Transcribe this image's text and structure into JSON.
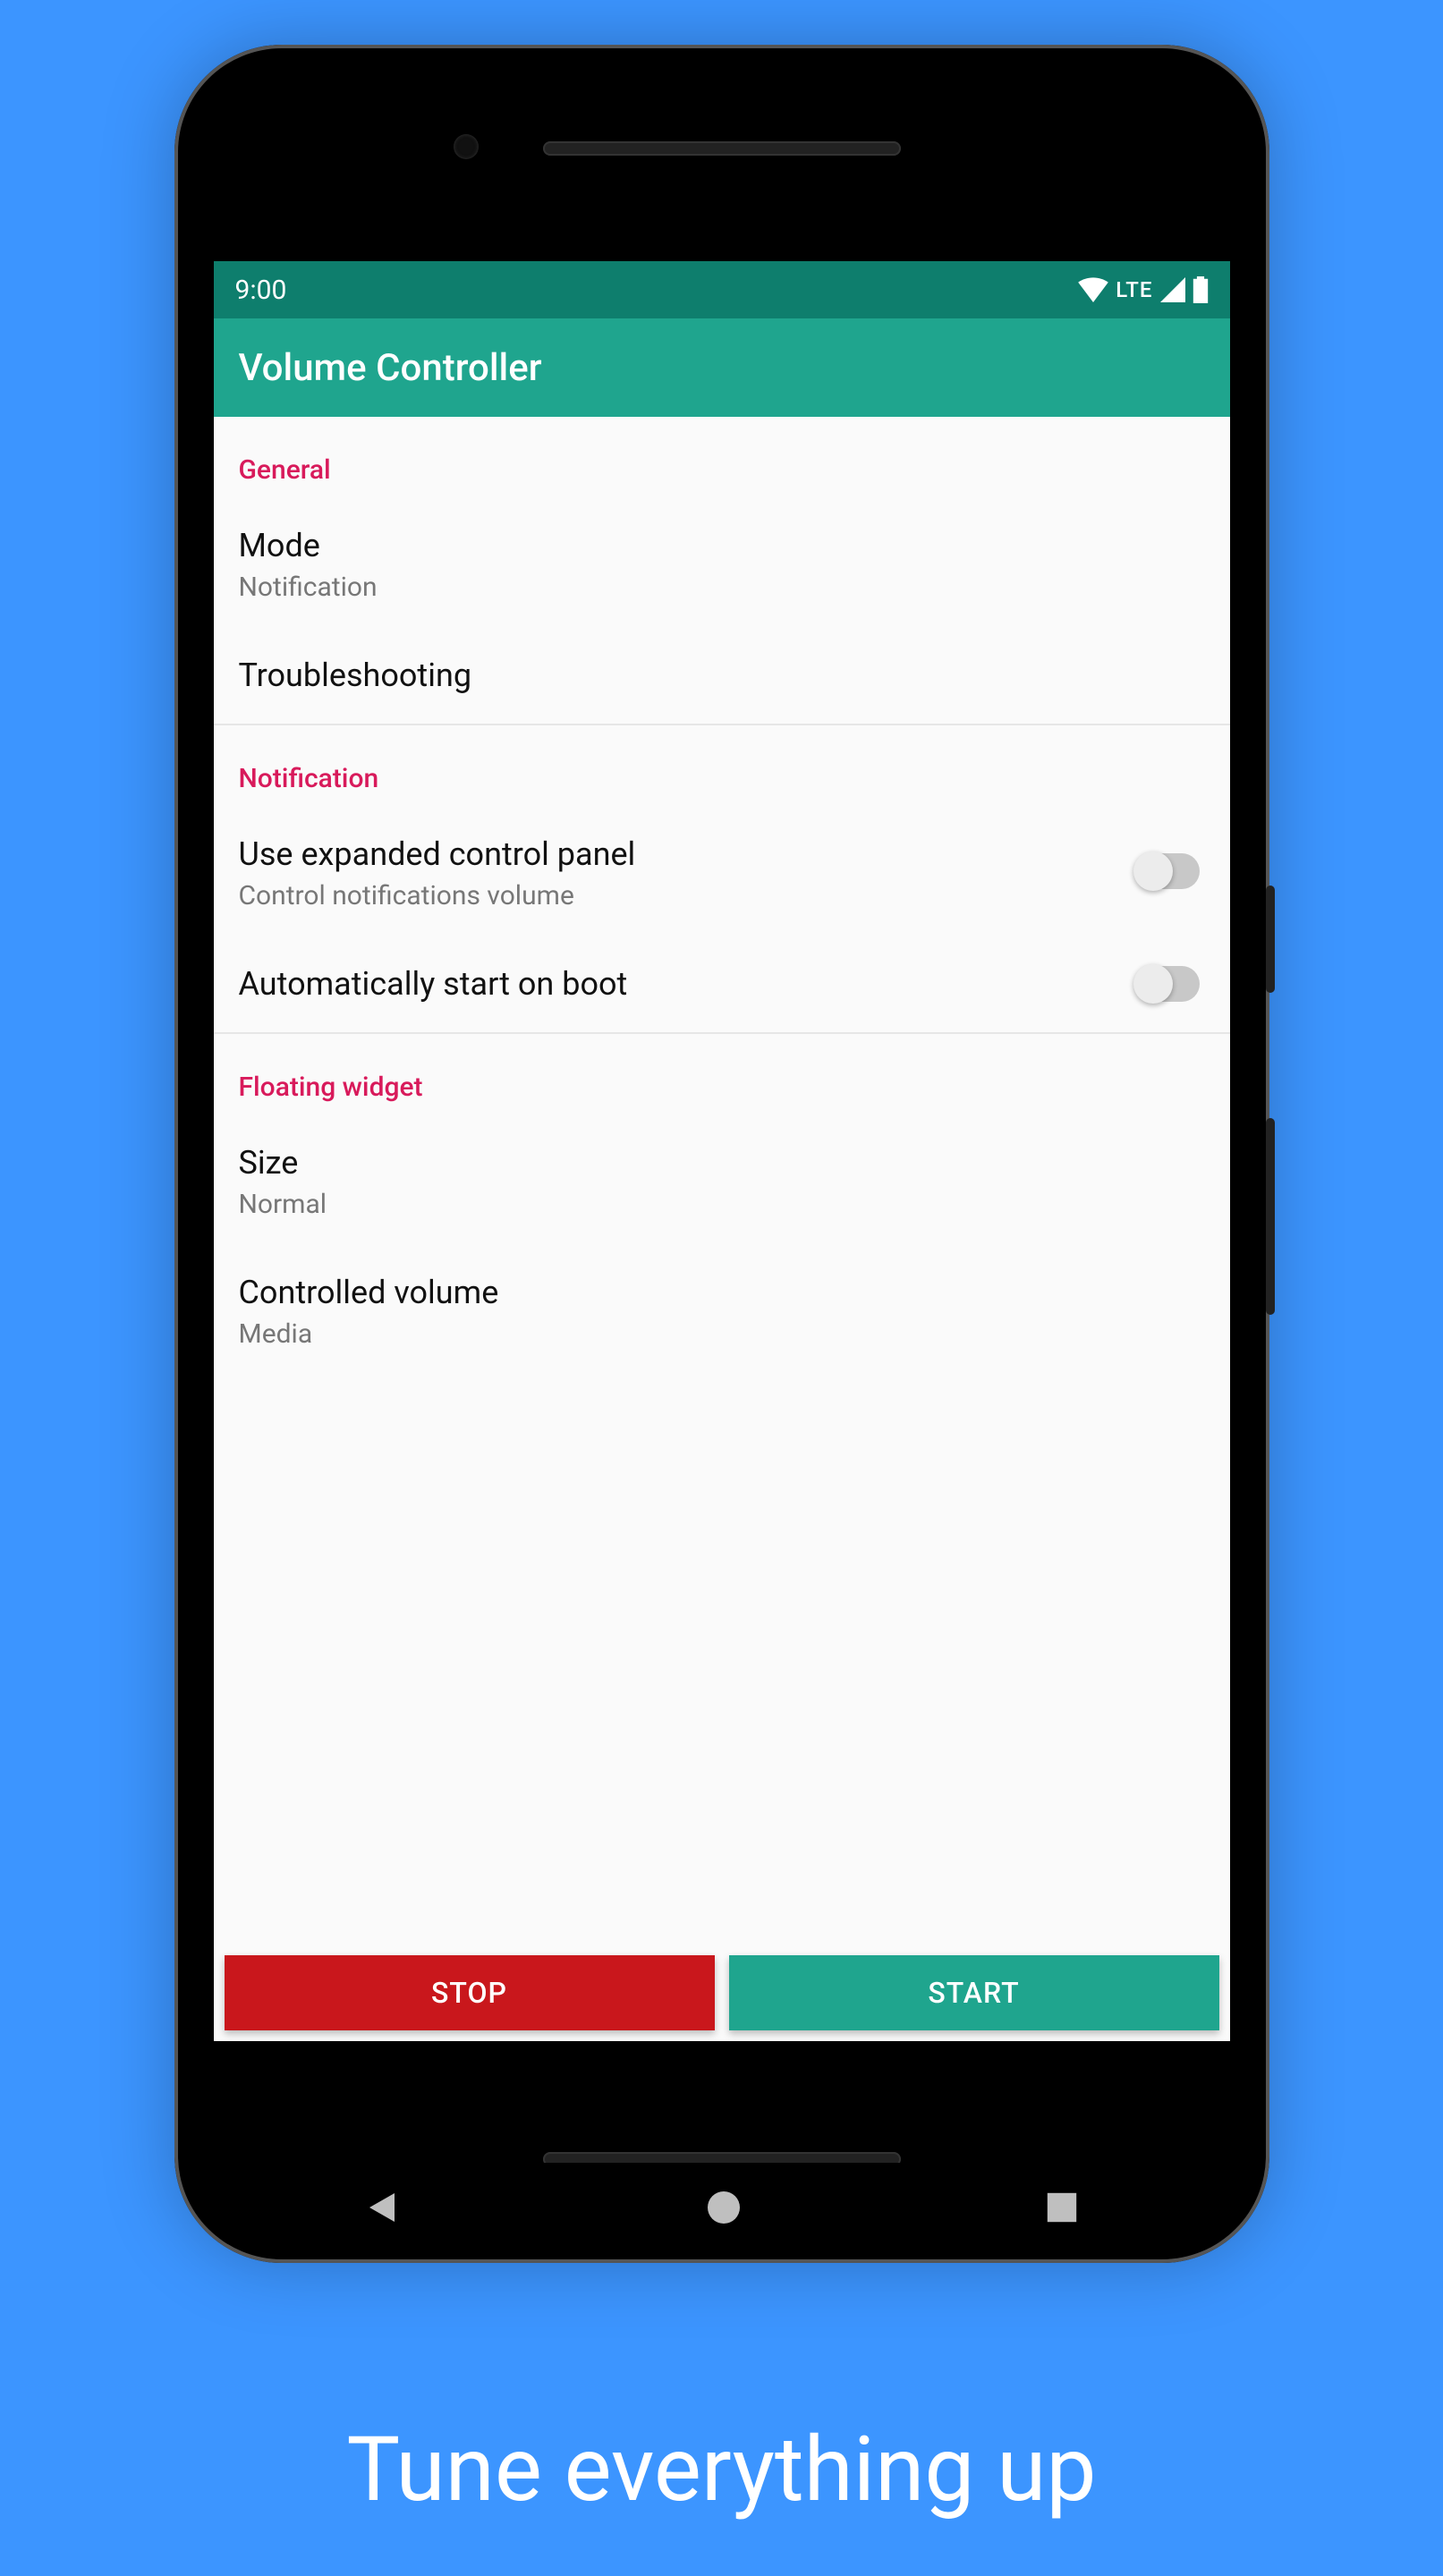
{
  "statusbar": {
    "time": "9:00",
    "network_label": "LTE"
  },
  "appbar": {
    "title": "Volume Controller"
  },
  "sections": {
    "general": {
      "header": "General",
      "mode": {
        "title": "Mode",
        "value": "Notification"
      },
      "troubleshooting": {
        "title": "Troubleshooting"
      }
    },
    "notification": {
      "header": "Notification",
      "expanded": {
        "title": "Use expanded control panel",
        "sub": "Control notifications volume",
        "checked": false
      },
      "autostart": {
        "title": "Automatically start on boot",
        "checked": false
      }
    },
    "floating": {
      "header": "Floating widget",
      "size": {
        "title": "Size",
        "value": "Normal"
      },
      "controlled": {
        "title": "Controlled volume",
        "value": "Media"
      }
    }
  },
  "buttons": {
    "stop": "STOP",
    "start": "START"
  },
  "promo": "Tune everything up"
}
